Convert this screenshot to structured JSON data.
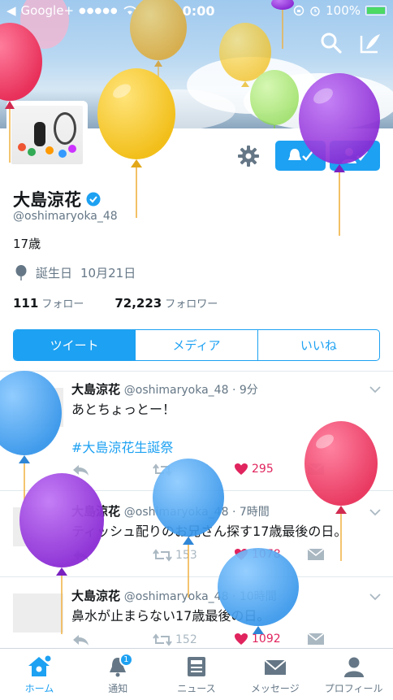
{
  "status_bar": {
    "carrier": "Google+",
    "signal": "●●●●●",
    "time": "0:00",
    "battery": "100%"
  },
  "profile": {
    "name": "大島涼花",
    "handle": "@oshimaryoka_48",
    "bio": "17歳",
    "birthday_label": "誕生日",
    "birthday_value": "10月21日",
    "following_count": "111",
    "following_label": "フォロー",
    "followers_count": "72,223",
    "followers_label": "フォロワー"
  },
  "tabs": [
    "ツイート",
    "メディア",
    "いいね"
  ],
  "tweets": [
    {
      "name": "大島涼花",
      "meta": "@oshimaryoka_48 · 9分",
      "text": "あとちょっとー！",
      "hashtag": "#大島涼花生誕祭",
      "likes": "295"
    },
    {
      "name": "大島涼花",
      "meta": "@oshimaryoka_48 · 7時間",
      "text": "ティッシュ配りのお兄さん探す17歳最後の日。",
      "retweets": "153",
      "likes": "1078"
    },
    {
      "name": "大島涼花",
      "meta": "@oshimaryoka_48 · 10時間",
      "text": "鼻水が止まらない17歳最後の日。",
      "retweets": "152",
      "likes": "1092"
    }
  ],
  "bottom_nav": {
    "home": "ホーム",
    "notifications": "通知",
    "notifications_badge": "1",
    "news": "ニュース",
    "messages": "メッセージ",
    "profile": "プロフィール"
  },
  "colors": {
    "accent": "#1da1f2",
    "like": "#e0245e",
    "balloon_yellow": "#f6c928",
    "balloon_purple": "#9b3de0",
    "balloon_blue": "#4aa8f5",
    "balloon_pink": "#f0476e"
  }
}
